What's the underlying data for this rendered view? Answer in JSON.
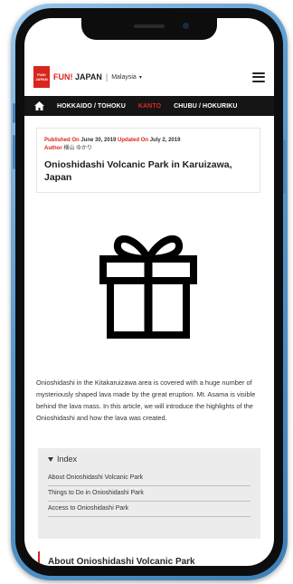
{
  "header": {
    "logo_text_top": "FUN!",
    "logo_text_bottom": "JAPAN",
    "brand_fun": "FUN!",
    "brand_japan": "JAPAN",
    "separator": "|",
    "region": "Malaysia",
    "region_caret": "▾",
    "menu_icon": "hamburger-icon"
  },
  "nav": {
    "home_icon": "home-icon",
    "items": [
      {
        "label": "HOKKAIDO / TOHOKU",
        "active": false
      },
      {
        "label": "KANTO",
        "active": true
      },
      {
        "label": "CHUBU / HOKURIKU",
        "active": false
      }
    ],
    "active_color": "#e02a20"
  },
  "article": {
    "published_label": "Published On",
    "published_date": "June 30, 2019",
    "updated_label": "Updated On",
    "updated_date": "July 2, 2019",
    "author_label": "Author",
    "author_name": "横山 ゆかり",
    "title": "Onioshidashi Volcanic Park in Karuizawa, Japan",
    "image_icon": "gift-icon",
    "intro": "Onioshidashi in the Kitakaruizawa area is covered with a huge number of mysteriously shaped lava made by the great eruption. Mt. Asama is visible behind the lava mass. In this article, we will introduce the highlights of the Onioshidashi and how the lava was created."
  },
  "index": {
    "heading": "Index",
    "items": [
      "About Onioshidashi Volcanic Park",
      "Things to Do in Onioshidashi Park",
      "Access to Onioshidashi Park"
    ]
  },
  "section": {
    "heading": "About Onioshidashi Volcanic Park"
  },
  "colors": {
    "brand_red": "#d9261c",
    "nav_bg": "#151515",
    "phone_frame": "#5b9bd0",
    "index_bg": "#ececec"
  }
}
